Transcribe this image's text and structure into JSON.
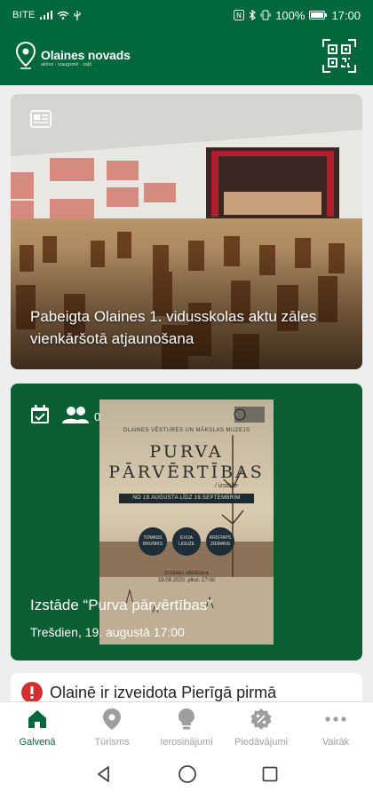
{
  "status_bar": {
    "carrier": "BITE",
    "battery": "100%",
    "time": "17:00"
  },
  "header": {
    "logo_title": "Olaines novads",
    "logo_subtitle": "aktīvs · izaugsmē · zaļš",
    "qr_icon": "qr-scan-icon"
  },
  "news_card": {
    "type_icon": "newspaper-icon",
    "title": "Pabeigta Olaines 1. vidusskolas aktu zāles vienkāršotā atjaunošana"
  },
  "event_card": {
    "calendar_icon": "calendar-check-icon",
    "people_icon": "people-icon",
    "attendee_count": "0",
    "title": "Izstāde “Purva pārvērtības”",
    "date": "Trešdien, 19. augustā 17:00",
    "poster": {
      "header": "OLAINES VĒSTURES UN MĀKSLAS MUZEJS",
      "title_line1": "PURVA",
      "title_line2": "PĀRVĒRTĪBAS",
      "subtitle": "/ izstāde",
      "dates": "NO 19.AUGUSTA LĪDZ 19.SEPTEMBRIM",
      "artists": [
        "TOMASS BRUNIKS",
        "EVIJA LIGUZE",
        "KRISTAPS ZIEMANS"
      ],
      "open_line1": "Izstādes atklāšana",
      "open_line2": "19.08.2020. plkst. 17:00"
    }
  },
  "alert_card": {
    "icon": "info-alert-icon",
    "title": "Olainē ir izveidota Pierīgā pirmā"
  },
  "bottom_nav": {
    "items": [
      {
        "label": "Galvenā",
        "icon": "home-icon",
        "active": true
      },
      {
        "label": "Tūrisms",
        "icon": "location-pin-icon",
        "active": false
      },
      {
        "label": "Ierosinājumi",
        "icon": "lightbulb-icon",
        "active": false
      },
      {
        "label": "Piedāvājumi",
        "icon": "discount-icon",
        "active": false
      },
      {
        "label": "Vairāk",
        "icon": "more-dots-icon",
        "active": false
      }
    ]
  },
  "colors": {
    "brand_green": "#00683a",
    "event_green": "#0b5e31",
    "inactive": "#9e9e9e",
    "alert_red": "#d32f2f"
  }
}
